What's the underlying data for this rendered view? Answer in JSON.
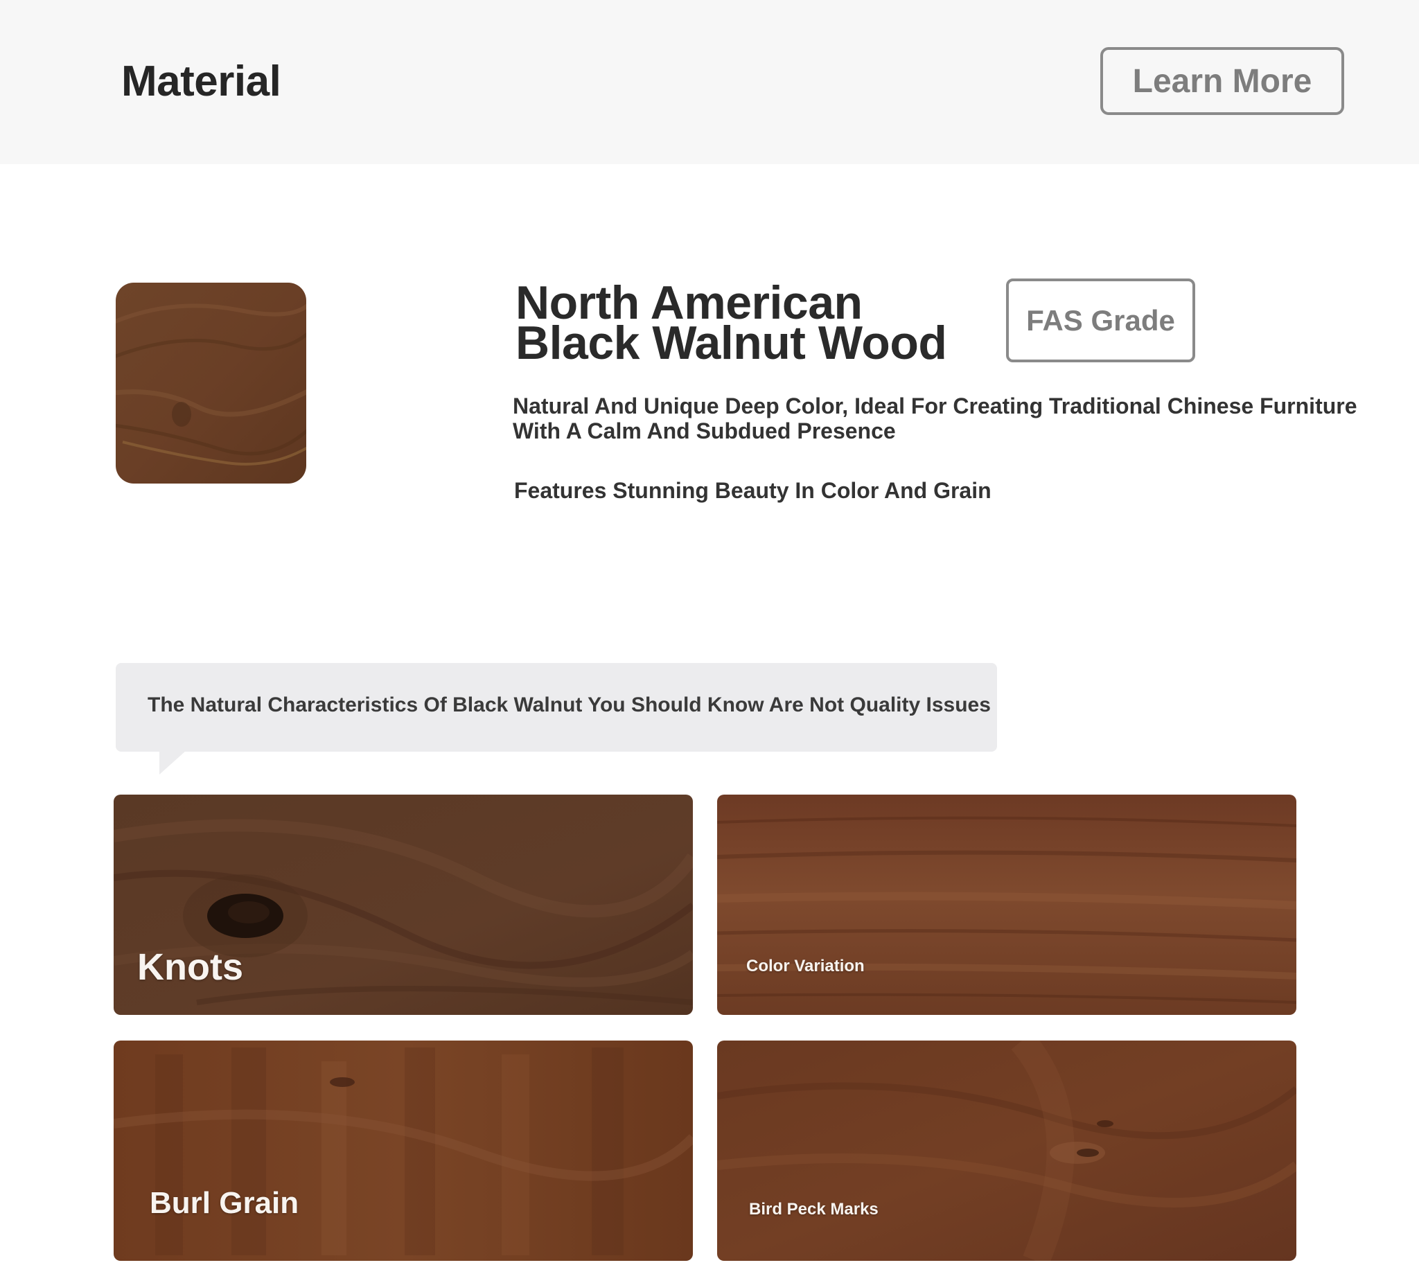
{
  "header": {
    "brand": "Material",
    "learn_more_label": "Learn More",
    "background": "#f7f7f7"
  },
  "product": {
    "title_line1": "North American",
    "title_line2": "Black Walnut Wood",
    "grade_badge": "FAS Grade",
    "description": "Natural And Unique Deep Color, Ideal For Creating Traditional Chinese Furniture With A Calm And Subdued Presence",
    "feature": "Features Stunning Beauty In Color And Grain",
    "swatch_color": "#6b4128"
  },
  "characteristics": {
    "heading": "The Natural Characteristics Of Black Walnut You Should Know Are Not Quality Issues",
    "items": [
      {
        "label": "Knots",
        "color": "#5d3a26"
      },
      {
        "label": "Color Variation",
        "color": "#7a4329"
      },
      {
        "label": "Burl Grain",
        "color": "#74401f"
      },
      {
        "label": "Bird Peck Marks",
        "color": "#6e3c22"
      }
    ]
  }
}
